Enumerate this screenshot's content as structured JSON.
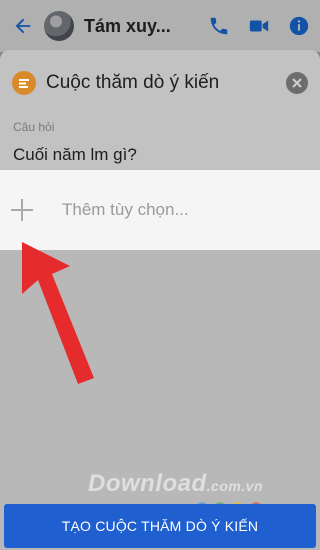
{
  "chat": {
    "name": "Tám xuy..."
  },
  "poll": {
    "title": "Cuộc thăm dò ý kiến",
    "question_label": "Câu hỏi",
    "question_text": "Cuối năm lm gì?",
    "option_placeholder": "Thêm tùy chọn..."
  },
  "create_button": {
    "label": "TẠO CUỘC THĂM DÒ Ý KIẾN"
  },
  "watermark": {
    "brand": "Download",
    "tld": ".com.vn"
  },
  "colors": {
    "accent": "#1f5fcf",
    "poll_icon": "#d98a2b",
    "arrow": "#e52b2b"
  },
  "icons": [
    "back-arrow-icon",
    "phone-icon",
    "video-camera-icon",
    "info-icon",
    "poll-icon",
    "close-icon",
    "plus-icon"
  ]
}
